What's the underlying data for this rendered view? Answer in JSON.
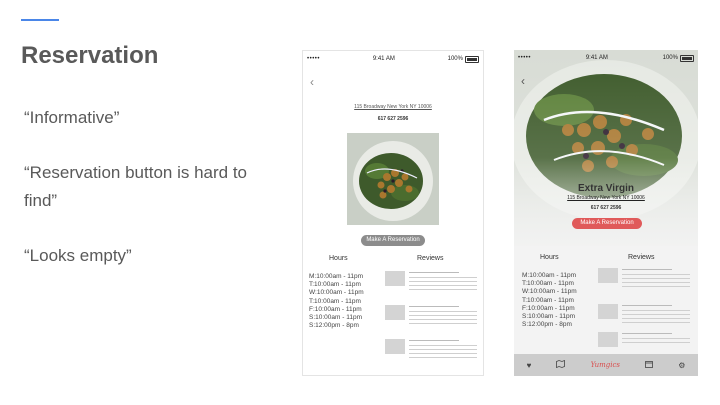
{
  "slide": {
    "title": "Reservation",
    "quotes": [
      "“Informative”",
      "“Reservation button is hard to find”",
      "“Looks empty”"
    ],
    "accent_color": "#4a86e8"
  },
  "phone_a": {
    "status": {
      "carrier": "•••••",
      "time": "9:41 AM",
      "battery": "100%"
    },
    "address": "115 Broadway New York NY 10006",
    "phone": "617 627 2596",
    "reserve_label": "Make A Reservation",
    "hours_label": "Hours",
    "reviews_label": "Reviews",
    "hours": [
      "M:10:00am - 11pm",
      "T:10:00am - 11pm",
      "W:10:00am - 11pm",
      "T:10:00am - 11pm",
      "F:10:00am - 11pm",
      "S:10:00am - 11pm",
      "S:12:00pm - 8pm"
    ]
  },
  "phone_b": {
    "status": {
      "carrier": "•••••",
      "time": "9:41 AM",
      "battery": "100%"
    },
    "restaurant": "Extra Virgin",
    "address": "115 Broadway New York NY 10006",
    "phone": "617 627 2596",
    "reserve_label": "Make A Reservation",
    "reserve_color": "#e05a5a",
    "hours_label": "Hours",
    "reviews_label": "Reviews",
    "hours": [
      "M:10:00am - 11pm",
      "T:10:00am - 11pm",
      "W:10:00am - 11pm",
      "T:10:00am - 11pm",
      "F:10:00am - 11pm",
      "S:10:00am - 11pm",
      "S:12:00pm - 8pm"
    ],
    "tab_brand": "Yumgics",
    "tab_icons": [
      "heart-icon",
      "map-icon",
      "calendar-icon",
      "gear-icon"
    ]
  }
}
